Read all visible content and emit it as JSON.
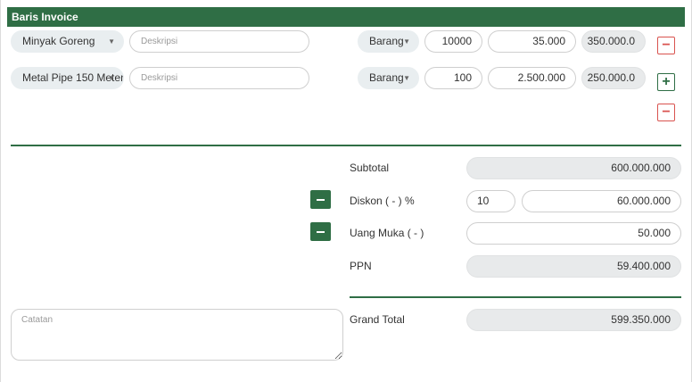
{
  "section_title": "Baris Invoice",
  "lines": [
    {
      "item": "Minyak Goreng",
      "description_placeholder": "Deskripsi",
      "unit": "Barang",
      "quantity": "10000",
      "price": "35.000",
      "amount": "350.000.0",
      "action": "−"
    },
    {
      "item": "Metal Pipe 150 Meter",
      "description_placeholder": "Deskripsi",
      "unit": "Barang",
      "quantity": "100",
      "price": "2.500.000",
      "amount": "250.000.0",
      "action": "+"
    }
  ],
  "extra_remove": "−",
  "summary": {
    "subtotal_label": "Subtotal",
    "subtotal_value": "600.000.000",
    "discount_label": "Diskon ( - ) %",
    "discount_percent": "10",
    "discount_value": "60.000.000",
    "down_payment_label": "Uang Muka ( - )",
    "down_payment_value": "50.000",
    "ppn_label": "PPN",
    "ppn_value": "59.400.000",
    "grand_total_label": "Grand Total",
    "grand_total_value": "599.350.000"
  },
  "notes_placeholder": "Catatan",
  "colors": {
    "accent": "#2f6e45",
    "danger": "#d9534f"
  }
}
